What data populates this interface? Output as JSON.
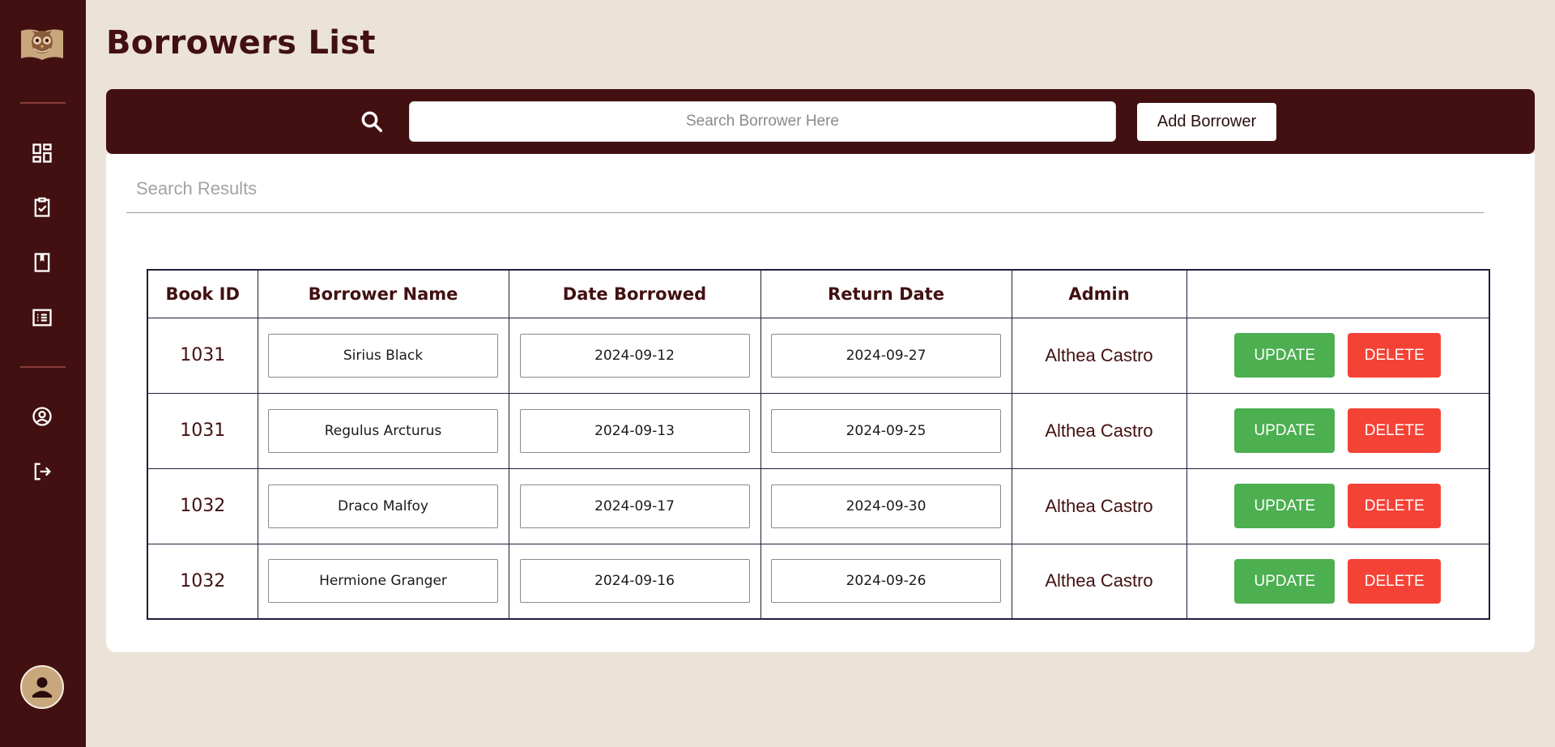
{
  "page": {
    "title": "Borrowers List"
  },
  "toolbar": {
    "search_placeholder": "Search Borrower Here",
    "add_label": "Add Borrower"
  },
  "results": {
    "heading": "Search Results",
    "columns": [
      "Book ID",
      "Borrower Name",
      "Date Borrowed",
      "Return Date",
      "Admin",
      ""
    ],
    "rows": [
      {
        "book_id": "1031",
        "name": "Sirius Black",
        "date_borrowed": "2024-09-12",
        "return_date": "2024-09-27",
        "admin": "Althea Castro"
      },
      {
        "book_id": "1031",
        "name": "Regulus Arcturus",
        "date_borrowed": "2024-09-13",
        "return_date": "2024-09-25",
        "admin": "Althea Castro"
      },
      {
        "book_id": "1032",
        "name": "Draco Malfoy",
        "date_borrowed": "2024-09-17",
        "return_date": "2024-09-30",
        "admin": "Althea Castro"
      },
      {
        "book_id": "1032",
        "name": "Hermione Granger",
        "date_borrowed": "2024-09-16",
        "return_date": "2024-09-26",
        "admin": "Althea Castro"
      }
    ],
    "update_label": "UPDATE",
    "delete_label": "DELETE"
  },
  "sidebar": {
    "icons": [
      "owl-book-logo",
      "dashboard-icon",
      "clipboard-check-icon",
      "book-icon",
      "list-icon",
      "user-circle-icon",
      "logout-icon",
      "avatar"
    ]
  },
  "colors": {
    "sidebar": "#421011",
    "background": "#ebe3d8",
    "update": "#4caf50",
    "delete": "#f44336"
  }
}
